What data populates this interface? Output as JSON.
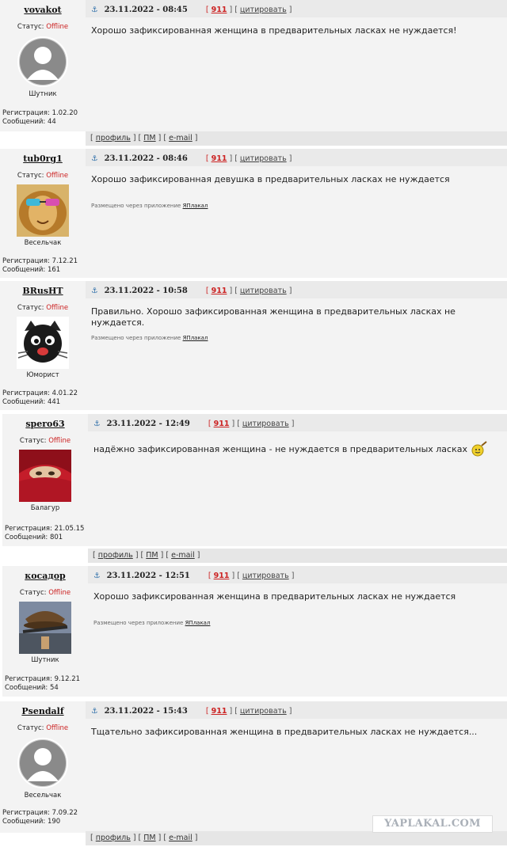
{
  "posts": [
    {
      "username": "vovakot",
      "date": "23.11.2022 - 08:45",
      "num": "911",
      "quote": "цитировать",
      "status_label": "Статус:",
      "status": "Offline",
      "rank": "Шутник",
      "reg": "Регистрация: 1.02.20",
      "msgs": "Сообщений: 44",
      "text": "Хорошо зафиксированная женщина в предварительных ласках не нуждается!",
      "avatar": "default-avatar"
    },
    {
      "username": "tub0rg1",
      "date": "23.11.2022 - 08:46",
      "num": "911",
      "quote": "цитировать",
      "status_label": "Статус:",
      "status": "Offline",
      "rank": "Весельчак",
      "reg": "Регистрация: 7.12.21",
      "msgs": "Сообщений: 161",
      "text": "Хорошо зафиксированная девушка в предварительных ласках не нуждается",
      "via_prefix": "Размещено через приложение",
      "via_app": "ЯПлакал",
      "avatar": "lion-avatar"
    },
    {
      "username": "BRusHT",
      "date": "23.11.2022 - 10:58",
      "num": "911",
      "quote": "цитировать",
      "status_label": "Статус:",
      "status": "Offline",
      "rank": "Юморист",
      "reg": "Регистрация: 4.01.22",
      "msgs": "Сообщений: 441",
      "text": "Правильно. Хорошо зафиксированная женщина в предварительных ласках не нуждается.",
      "via_prefix": "Размещено через приложение",
      "via_app": "ЯПлакал",
      "avatar": "cat-avatar"
    },
    {
      "username": "spero63",
      "date": "23.11.2022 - 12:49",
      "num": "911",
      "quote": "цитировать",
      "status_label": "Статус:",
      "status": "Offline",
      "rank": "Балагур",
      "reg": "Регистрация: 21.05.15",
      "msgs": "Сообщений: 801",
      "text": "надёжно зафиксированная женщина - не нуждается в предварительных ласках",
      "avatar": "red-hood-avatar"
    },
    {
      "username": "косадор",
      "date": "23.11.2022 - 12:51",
      "num": "911",
      "quote": "цитировать",
      "status_label": "Статус:",
      "status": "Offline",
      "rank": "Шутник",
      "reg": "Регистрация: 9.12.21",
      "msgs": "Сообщений: 54",
      "text": "Хорошо зафиксированная женщина в предварительных ласках не нуждается",
      "via_prefix": "Размещено через приложение",
      "via_app": "ЯПлакал",
      "avatar": "hat-avatar"
    },
    {
      "username": "Psendalf",
      "date": "23.11.2022 - 15:43",
      "num": "911",
      "quote": "цитировать",
      "status_label": "Статус:",
      "status": "Offline",
      "rank": "Весельчак",
      "reg": "Регистрация: 7.09.22",
      "msgs": "Сообщений: 190",
      "text": "Тщательно зафиксированная женщина в предварительных ласках не нуждается...",
      "avatar": "default-avatar"
    }
  ],
  "footer": {
    "profile": "профиль",
    "pm": "ПМ",
    "email": "e-mail"
  },
  "watermark": "YAPLAKAL.COM",
  "icons": {
    "anchor": "anchor-icon",
    "apple": "apple-icon",
    "smiley": "smiley-icon"
  },
  "colors": {
    "offline": "#cc2222",
    "num": "#cc2222",
    "bg": "#f3f3f3"
  }
}
